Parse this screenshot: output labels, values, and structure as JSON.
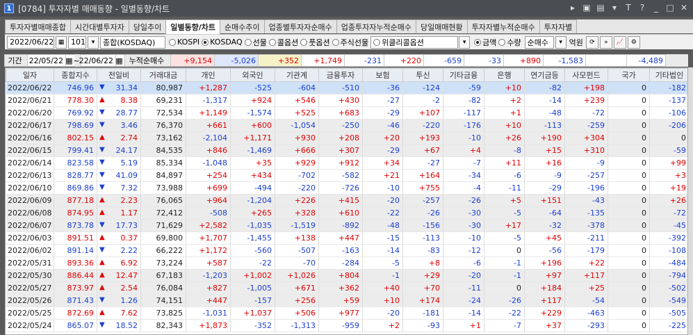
{
  "window": {
    "number": "1",
    "title": "[0784] 투자자별 매매동향 - 일별동향/차트"
  },
  "window_controls": [
    "▸",
    "▣",
    "▤",
    "▾",
    "T",
    "?",
    "_",
    "□",
    "✕"
  ],
  "tabs": [
    "투자자별매매종합",
    "시간대별투자자",
    "당일추이",
    "일별동향/차트",
    "순매수추이",
    "업종별투자자순매수",
    "업종투자자누적순매수",
    "당일매매현황",
    "투자자별누적순매수",
    "투자자별"
  ],
  "active_tab": 3,
  "controls": {
    "date": "2022/06/22",
    "code": "101",
    "market_name": "종합(KOSDAQ)",
    "markets": [
      "KOSPI",
      "KOSDAQ",
      "선물",
      "콜옵션",
      "풋옵션",
      "주식선물",
      "위클리콜옵션"
    ],
    "market_selected": 1,
    "unit_options": [
      "금액",
      "수량"
    ],
    "unit_selected": 0,
    "buy_type": "순매수",
    "unit_label": "억원"
  },
  "summary": {
    "label": "기간",
    "from": "22/05/22",
    "tilde": "~",
    "to": "22/06/22",
    "cum_label": "누적순매수",
    "values": [
      "+9,154",
      "-5,026",
      "+352",
      "+1,749",
      "-231",
      "+220",
      "-659",
      "-33",
      "+890",
      "-1,583",
      "",
      "-4,489"
    ]
  },
  "columns": [
    "일자",
    "종합지수",
    "전일비",
    "거래대금",
    "개인",
    "외국인",
    "기관계",
    "금융투자",
    "보험",
    "투신",
    "기타금융",
    "은행",
    "연기금등",
    "사모펀드",
    "국가",
    "기타법인"
  ],
  "rows": [
    [
      "2022/06/22",
      "746.96",
      "▼",
      "31.34",
      "80,987",
      "+1,287",
      "-525",
      "-604",
      "-510",
      "-36",
      "-124",
      "-59",
      "+10",
      "-82",
      "+198",
      "0",
      "-182"
    ],
    [
      "2022/06/21",
      "778.30",
      "▲",
      "8.38",
      "69,231",
      "-1,317",
      "+924",
      "+546",
      "+430",
      "-27",
      "-2",
      "-82",
      "+2",
      "-14",
      "+239",
      "0",
      "-137"
    ],
    [
      "2022/06/20",
      "769.92",
      "▼",
      "28.77",
      "72,534",
      "+1,149",
      "-1,574",
      "+525",
      "+683",
      "-29",
      "+107",
      "-117",
      "+1",
      "-48",
      "-72",
      "0",
      "-106"
    ],
    [
      "2022/06/17",
      "798.69",
      "▼",
      "3.46",
      "76,370",
      "+661",
      "+600",
      "-1,054",
      "-250",
      "-46",
      "-220",
      "-176",
      "+10",
      "-113",
      "-259",
      "0",
      "-206"
    ],
    [
      "2022/06/16",
      "802.15",
      "▲",
      "2.74",
      "73,162",
      "-2,104",
      "+1,171",
      "+930",
      "+208",
      "+20",
      "+193",
      "-10",
      "+26",
      "+190",
      "+304",
      "0",
      "0"
    ],
    [
      "2022/06/15",
      "799.41",
      "▼",
      "24.17",
      "84,535",
      "+846",
      "-1,469",
      "+666",
      "+307",
      "-29",
      "+67",
      "+4",
      "-8",
      "+15",
      "+310",
      "0",
      "-59"
    ],
    [
      "2022/06/14",
      "823.58",
      "▼",
      "5.19",
      "85,334",
      "-1,048",
      "+35",
      "+929",
      "+912",
      "+34",
      "-27",
      "-7",
      "+11",
      "+16",
      "-9",
      "0",
      "+99"
    ],
    [
      "2022/06/13",
      "828.77",
      "▼",
      "41.09",
      "84,897",
      "+254",
      "+434",
      "-702",
      "-582",
      "+21",
      "+164",
      "-34",
      "-6",
      "-9",
      "-257",
      "0",
      "+3"
    ],
    [
      "2022/06/10",
      "869.86",
      "▼",
      "7.32",
      "73,988",
      "+699",
      "-494",
      "-220",
      "-726",
      "-10",
      "+755",
      "-4",
      "-11",
      "-29",
      "-196",
      "0",
      "+19"
    ],
    [
      "2022/06/09",
      "877.18",
      "▲",
      "2.23",
      "76,065",
      "+964",
      "-1,204",
      "+226",
      "+415",
      "-20",
      "-257",
      "-26",
      "+5",
      "+151",
      "-43",
      "0",
      "+26"
    ],
    [
      "2022/06/08",
      "874.95",
      "▲",
      "1.17",
      "72,412",
      "-508",
      "+265",
      "+328",
      "+610",
      "-22",
      "-26",
      "-30",
      "-5",
      "-64",
      "-135",
      "0",
      "-72"
    ],
    [
      "2022/06/07",
      "873.78",
      "▼",
      "17.73",
      "71,629",
      "+2,582",
      "-1,035",
      "-1,519",
      "-892",
      "-48",
      "-156",
      "-30",
      "+17",
      "-32",
      "-378",
      "0",
      "-45"
    ],
    [
      "2022/06/03",
      "891.51",
      "▲",
      "0.37",
      "69,800",
      "+1,707",
      "-1,455",
      "+138",
      "+447",
      "-15",
      "-113",
      "-10",
      "-5",
      "+45",
      "-211",
      "0",
      "-392"
    ],
    [
      "2022/06/02",
      "891.14",
      "▼",
      "2.22",
      "66,222",
      "+1,172",
      "-560",
      "-507",
      "-163",
      "-14",
      "-83",
      "-12",
      "0",
      "-56",
      "-179",
      "0",
      "-108"
    ],
    [
      "2022/05/31",
      "893.36",
      "▲",
      "6.92",
      "73,224",
      "+587",
      "-22",
      "-70",
      "-284",
      "-5",
      "+8",
      "-6",
      "-1",
      "+196",
      "+22",
      "0",
      "-484"
    ],
    [
      "2022/05/30",
      "886.44",
      "▲",
      "12.47",
      "67,183",
      "-1,203",
      "+1,002",
      "+1,026",
      "+804",
      "-1",
      "+29",
      "-20",
      "-1",
      "+97",
      "+117",
      "0",
      "-794"
    ],
    [
      "2022/05/27",
      "873.97",
      "▲",
      "2.54",
      "76,084",
      "+827",
      "-1,005",
      "+671",
      "+362",
      "+40",
      "+70",
      "-11",
      "0",
      "+184",
      "+25",
      "0",
      "-502"
    ],
    [
      "2022/05/26",
      "871.43",
      "▼",
      "1.26",
      "74,151",
      "+447",
      "-157",
      "+256",
      "+59",
      "+10",
      "+174",
      "-24",
      "-26",
      "+117",
      "-54",
      "0",
      "-549"
    ],
    [
      "2022/05/25",
      "872.69",
      "▲",
      "7.62",
      "73,825",
      "-1,031",
      "+1,037",
      "+506",
      "+977",
      "-20",
      "-181",
      "-14",
      "-22",
      "+229",
      "-463",
      "0",
      "-505"
    ],
    [
      "2022/05/24",
      "865.07",
      "▼",
      "18.52",
      "82,343",
      "+1,873",
      "-352",
      "-1,313",
      "-959",
      "+2",
      "-93",
      "+1",
      "-7",
      "+37",
      "-293",
      "0",
      "-225"
    ]
  ],
  "colors": {
    "up": "#e00000",
    "down": "#1a3fcf",
    "selected_row": "#cfe1f7",
    "header_bg": "#e8ecf3"
  }
}
